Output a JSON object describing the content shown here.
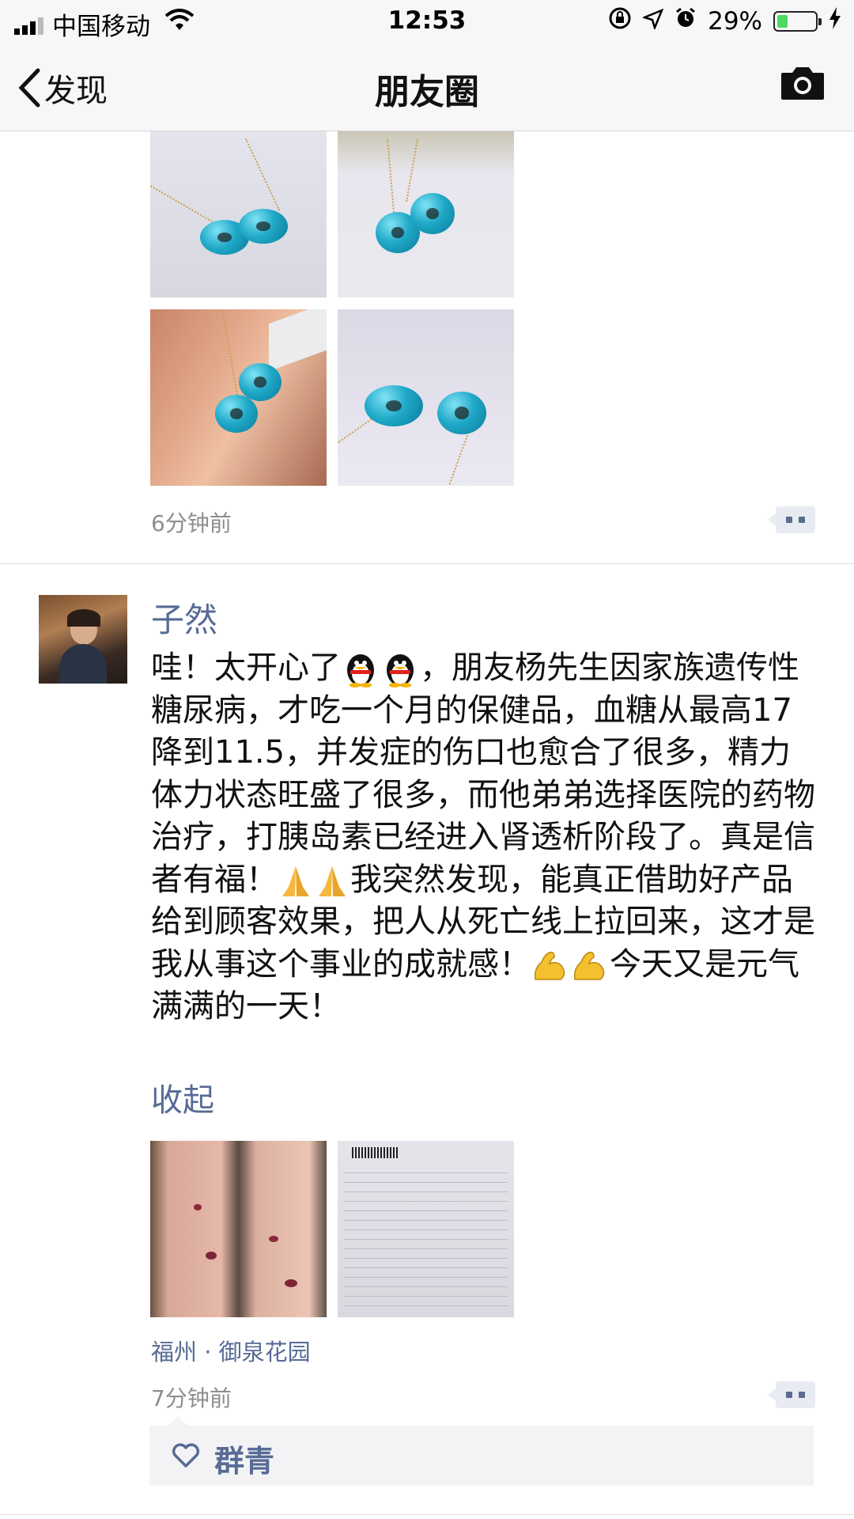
{
  "status_bar": {
    "carrier": "中国移动",
    "time": "12:53",
    "battery_text": "29%",
    "battery_level": 0.29,
    "icons": [
      "signal-icon",
      "wifi-icon",
      "orientation-lock-icon",
      "location-icon",
      "alarm-icon",
      "battery-icon",
      "charging-icon"
    ]
  },
  "nav": {
    "back_label": "发现",
    "title": "朋友圈",
    "camera_icon": "camera-icon"
  },
  "post1": {
    "time": "6分钟前",
    "photos": [
      "turquoise-pendant-1",
      "turquoise-pendant-2",
      "turquoise-pendant-on-finger",
      "turquoise-pendant-4"
    ]
  },
  "post2": {
    "author": "子然",
    "text_parts": [
      "哇！太开心了",
      "，朋友杨先生因家族遗传性糖尿病，才吃一个月的保健品，血糖从最高17降到11.5，并发症的伤口也愈合了很多，精力体力状态旺盛了很多，而他弟弟选择医院的药物治疗，打胰岛素已经进入肾透析阶段了。真是信者有福！",
      "我突然发现，能真正借助好产品给到顾客效果，把人从死亡线上拉回来，这才是我从事这个事业的成就感！",
      "今天又是元气满满的一天！"
    ],
    "collapse_label": "收起",
    "photos": [
      "arm-wound-photo",
      "medical-report-photo"
    ],
    "location": "福州 · 御泉花园",
    "time": "7分钟前",
    "likes": [
      "群青"
    ]
  },
  "colors": {
    "link_blue": "#576b95",
    "meta_gray": "#8d8d8d",
    "bar_bg": "#f7f7f7",
    "battery_green": "#4cd964"
  }
}
